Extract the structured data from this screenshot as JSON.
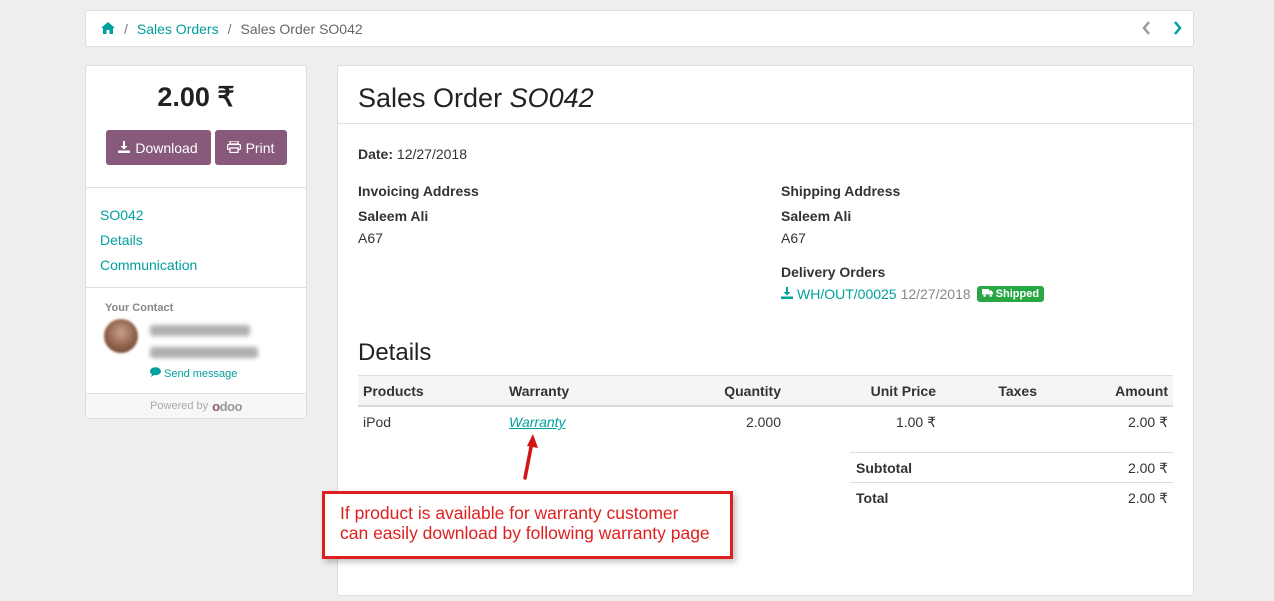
{
  "breadcrumb": {
    "items": [
      "Sales Orders"
    ],
    "current": "Sales Order SO042"
  },
  "sidebar": {
    "total": "2.00 ₹",
    "download_label": "Download",
    "print_label": "Print",
    "links": [
      "SO042",
      "Details",
      "Communication"
    ],
    "contact_label": "Your Contact",
    "send_message": "Send message",
    "powered_by": "Powered by",
    "brand": "odoo"
  },
  "order": {
    "title_prefix": "Sales Order",
    "number": "SO042",
    "date_label": "Date:",
    "date": "12/27/2018",
    "invoicing": {
      "heading": "Invoicing Address",
      "name": "Saleem Ali",
      "street": "A67"
    },
    "shipping": {
      "heading": "Shipping Address",
      "name": "Saleem Ali",
      "street": "A67"
    },
    "delivery": {
      "heading": "Delivery Orders",
      "ref": "WH/OUT/00025",
      "date": "12/27/2018",
      "status": "Shipped"
    },
    "details_title": "Details",
    "columns": [
      "Products",
      "Warranty",
      "Quantity",
      "Unit Price",
      "Taxes",
      "Amount"
    ],
    "line": {
      "product": "iPod",
      "warranty": "Warranty",
      "quantity": "2.000",
      "unit_price": "1.00 ₹",
      "taxes": "",
      "amount": "2.00 ₹"
    },
    "subtotal_label": "Subtotal",
    "subtotal": "2.00 ₹",
    "total_label": "Total",
    "total": "2.00 ₹"
  },
  "callout": {
    "line1": "If product is available for warranty customer",
    "line2": "can easily download by following warranty page"
  },
  "colors": {
    "accent": "#00A09D",
    "button": "#875A7B",
    "badge": "#28a745",
    "callout": "#dd1f1f"
  }
}
